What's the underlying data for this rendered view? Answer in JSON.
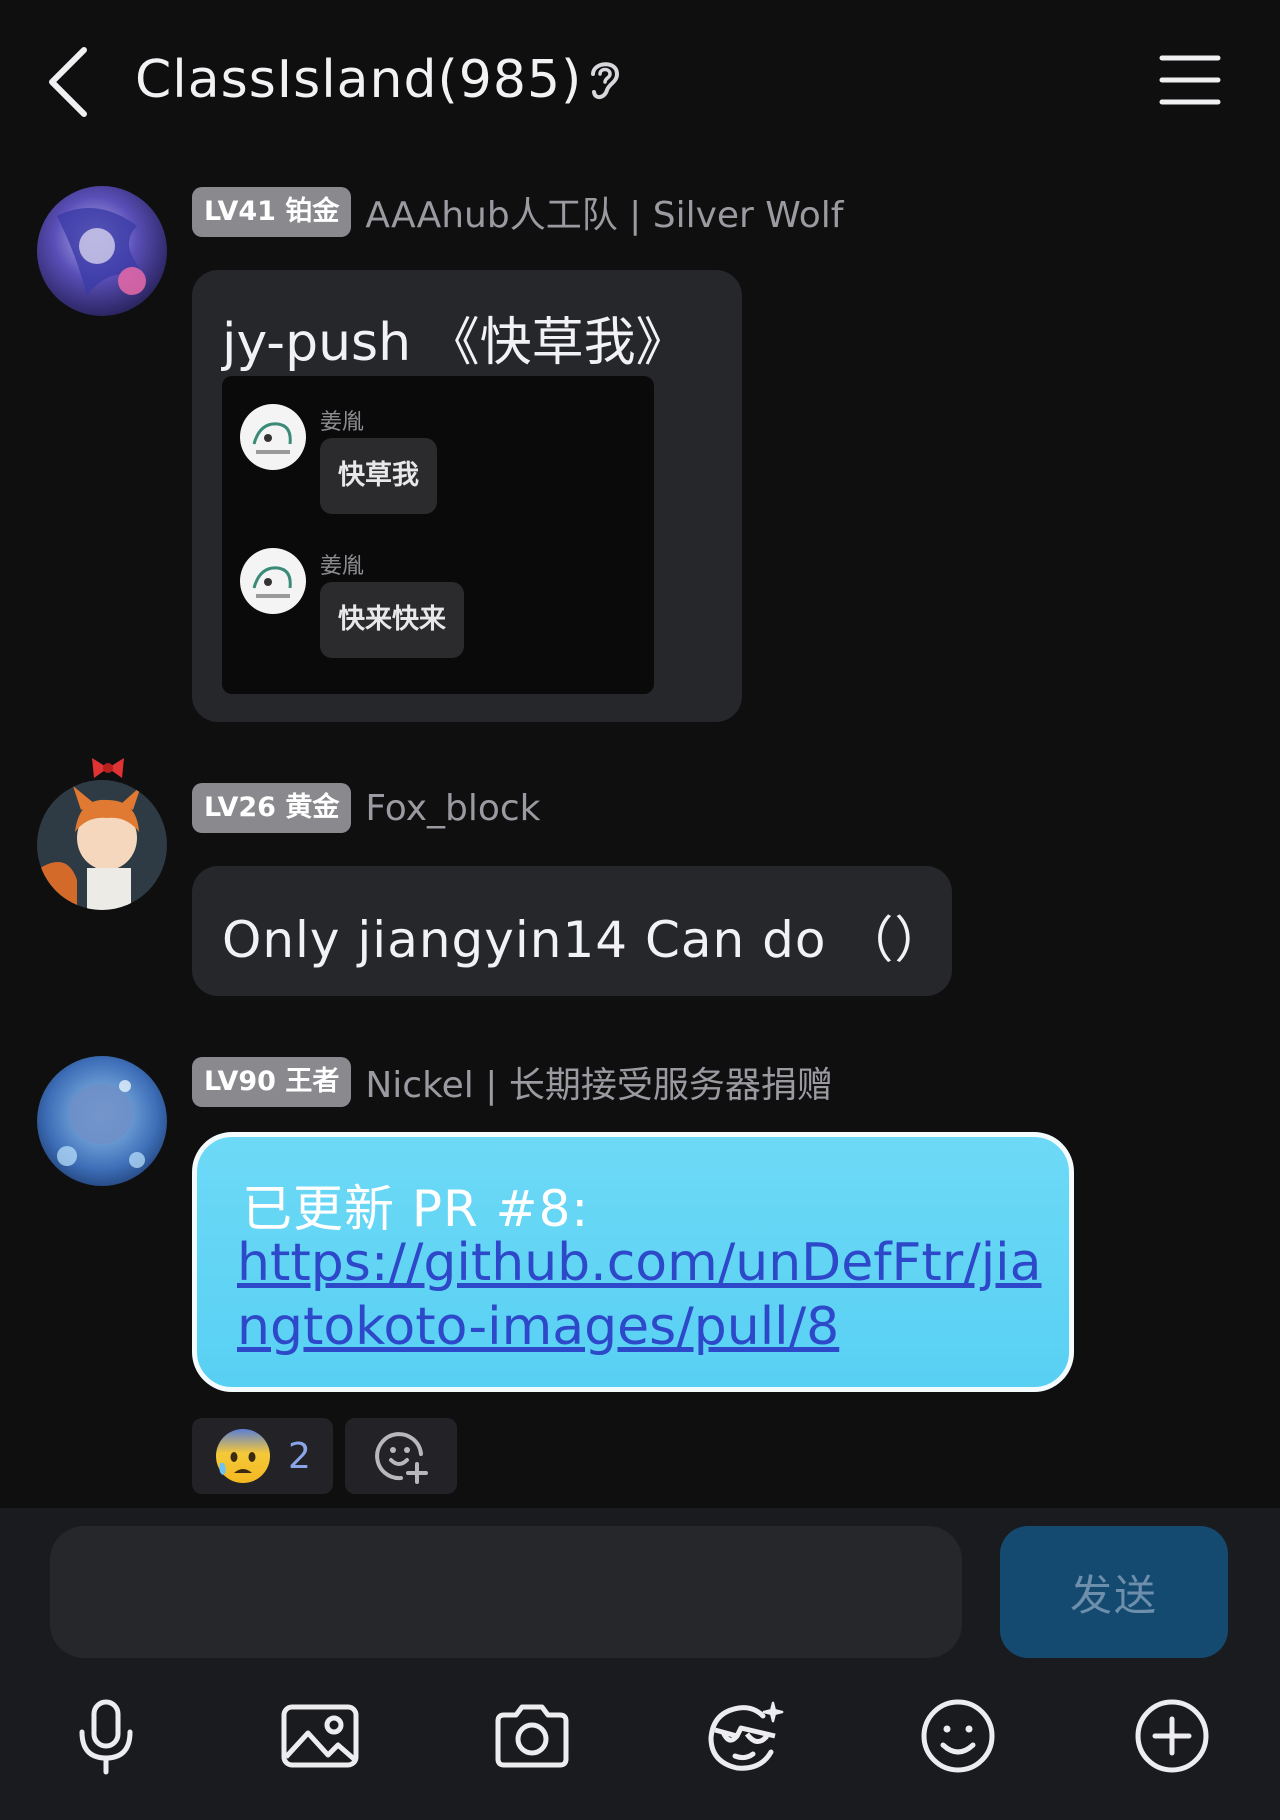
{
  "header": {
    "title": "ClassIsland(985)"
  },
  "messages": [
    {
      "level": "LV41 铂金",
      "name": "AAAhub人工队 | Silver Wolf",
      "text": "jy-push 《快草我》",
      "quoted": [
        {
          "name": "姜胤",
          "text": "快草我"
        },
        {
          "name": "姜胤",
          "text": "快来快来"
        }
      ]
    },
    {
      "level": "LV26 黄金",
      "name": "Fox_block",
      "text": "Only jiangyin14 Can do （）"
    },
    {
      "level": "LV90 王者",
      "name": "Nickel | 长期接受服务器捐赠",
      "text_prefix": "已更新 PR #8:",
      "link": "https://github.com/unDefFtr/jiangtokoto-images/pull/8",
      "reactions": [
        {
          "emoji": "😰",
          "count": "2"
        }
      ]
    }
  ],
  "input": {
    "send_label": "发送"
  }
}
